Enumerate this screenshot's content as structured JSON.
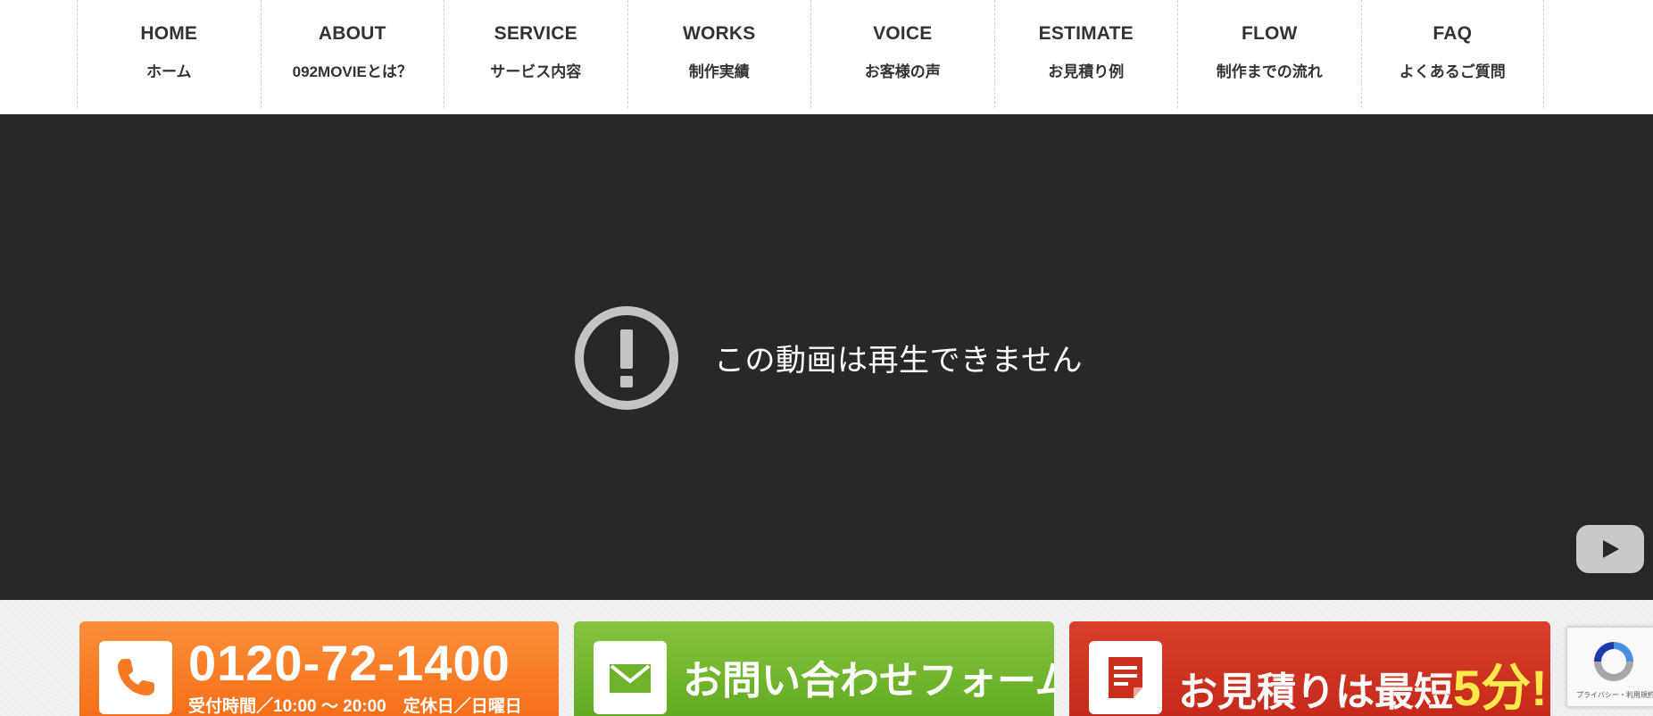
{
  "nav": {
    "items": [
      {
        "en": "HOME",
        "ja": "ホーム"
      },
      {
        "en": "ABOUT",
        "ja": "092MOVIEとは？"
      },
      {
        "en": "SERVICE",
        "ja": "サービス内容"
      },
      {
        "en": "WORKS",
        "ja": "制作実績"
      },
      {
        "en": "VOICE",
        "ja": "お客様の声"
      },
      {
        "en": "ESTIMATE",
        "ja": "お見積り例"
      },
      {
        "en": "FLOW",
        "ja": "制作までの流れ"
      },
      {
        "en": "FAQ",
        "ja": "よくあるご質問"
      }
    ]
  },
  "video": {
    "error_message": "この動画は再生できません"
  },
  "cta": {
    "phone_number": "0120-72-1400",
    "phone_hours": "受付時間／10:00 ～ 20:00　定休日／日曜日",
    "mail_label": "お問い合わせフォーム",
    "estimate_label": "お見積りは最短",
    "estimate_highlight": "5分!"
  },
  "recaptcha": {
    "footer": "プライバシー・利用規約"
  },
  "colors": {
    "phone": "#f66e17",
    "mail": "#61a922",
    "estimate": "#c4281a",
    "video_bg": "#282828"
  }
}
